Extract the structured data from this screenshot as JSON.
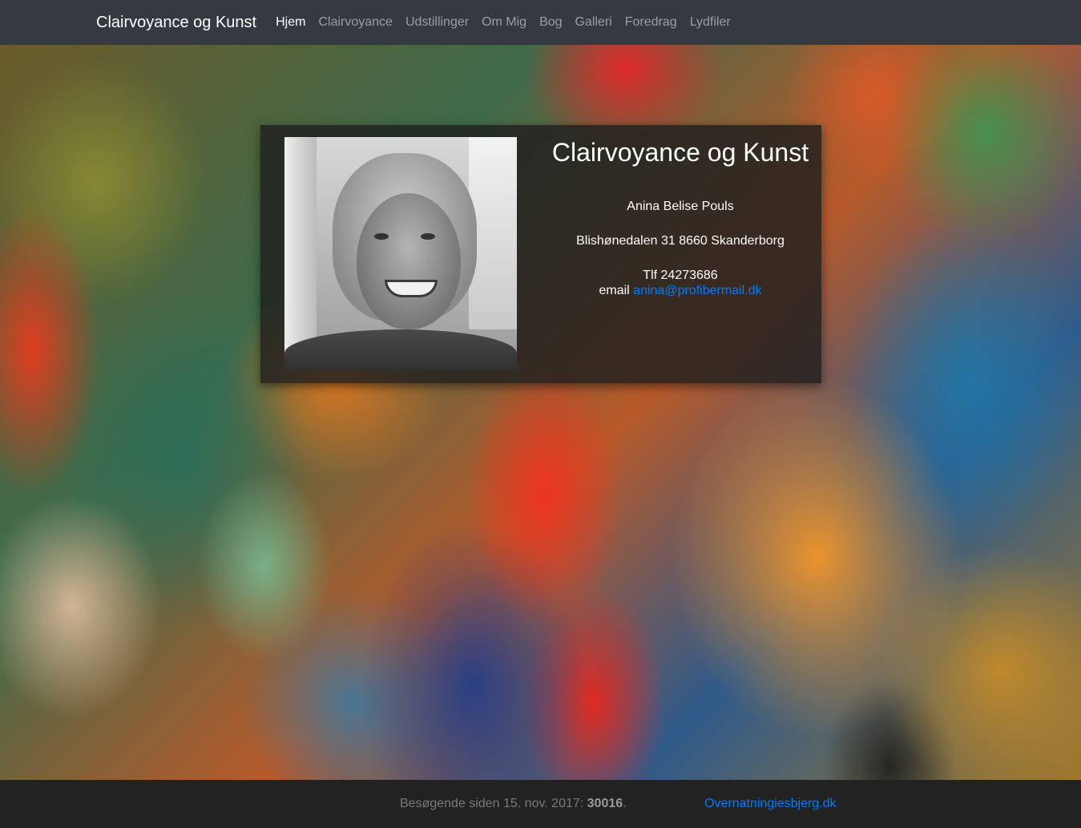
{
  "navbar": {
    "brand": "Clairvoyance og Kunst",
    "items": [
      {
        "label": "Hjem",
        "active": true
      },
      {
        "label": "Clairvoyance"
      },
      {
        "label": "Udstillinger"
      },
      {
        "label": "Om Mig"
      },
      {
        "label": "Bog"
      },
      {
        "label": "Galleri"
      },
      {
        "label": "Foredrag"
      },
      {
        "label": "Lydfiler"
      }
    ]
  },
  "card": {
    "title": "Clairvoyance og Kunst",
    "name": "Anina Belise Pouls",
    "address": "Blishønedalen 31 8660 Skanderborg",
    "phone": "Tlf 24273686",
    "email_prefix": "email",
    "email": "anina@profibermail.dk"
  },
  "footer": {
    "visitors_text": "Besøgende siden 15. nov. 2017:",
    "visitors_count": "30016",
    "visitors_suffix": ".",
    "link": "Overnatningiesbjerg.dk"
  },
  "colors": {
    "navbar_bg": "#343a40",
    "link": "#007bff",
    "footer_bg": "#222222"
  }
}
